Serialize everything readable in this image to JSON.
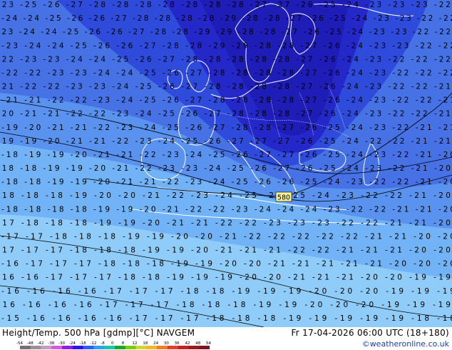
{
  "header": {
    "title": "Height/Temp. 500 hPa [gdmp][°C] NAVGEM",
    "datetime": "Fr 17-04-2026 06:00 UTC (18+180)",
    "credit": "©weatheronline.co.uk"
  },
  "contour_label": "580",
  "colorbar": {
    "ticks": [
      "-54",
      "-48",
      "-42",
      "-38",
      "-30",
      "-24",
      "-18",
      "-12",
      "-8",
      "0",
      "8",
      "12",
      "18",
      "24",
      "30",
      "36",
      "42",
      "48",
      "54"
    ],
    "colors": [
      "#7d6d77",
      "#9d8f98",
      "#c59cc6",
      "#d45bd9",
      "#8e1fdc",
      "#2b14e7",
      "#2f5ff2",
      "#2fa2ec",
      "#16c7a9",
      "#16a82b",
      "#7dcb0f",
      "#d0d72e",
      "#f2b524",
      "#ee7f25",
      "#e2402a",
      "#c61f25",
      "#9e1820",
      "#7a1420"
    ]
  },
  "temperature_rows": [
    "-23 -25 -26 -27 -28 -28 -28 -28 -28 -28 -28 -27 -27 -26 -25 -24 -23 -23 -23 -22",
    "-24 -24 -25 -26 -26 -27 -28 -28 -28 -28 -29 -28 -28 -27 -26 -25 -24 -23 -23 -22 -22",
    "-23 -24 -24 -25 -26 -26 -27 -28 -28 -29 -29 -28 -28 -27 -26 -25 -24 -23 -23 -22 -22",
    "-23 -24 -24 -25 -26 -26 -27 -28 -28 -29 -29 -28 -28 -27 -26 -24 -23 -23 -22 -22",
    "-22 -23 -23 -24 -24 -25 -26 -27 -28 -28 -28 -28 -28 -27 -26 -24 -23 -22 -22 -22",
    "-22 -22 -23 -23 -24 -24 -25 -26 -27 -28 -28 -28 -28 -27 -26 -24 -23 -22 -22 -22",
    "-21 -22 -22 -23 -23 -24 -25 -26 -27 -28 -28 -28 -28 -27 -26 -24 -23 -22 -22 -21",
    "-21 -21 -22 -22 -23 -24 -25 -26 -27 -28 -28 -28 -28 -27 -26 -24 -23 -22 -22 -21",
    "-20 -21 -21 -22 -22 -23 -24 -25 -26 -27 -28 -28 -28 -27 -26 -24 -23 -22 -22 -21",
    "-19 -20 -21 -21 -22 -23 -24 -25 -26 -27 -28 -28 -27 -26 -25 -24 -23 -22 -21 -21",
    "-19 -19 -20 -21 -21 -22 -23 -24 -25 -26 -27 -27 -27 -26 -25 -24 -22 -22 -21 -21",
    "-18 -19 -19 -20 -21 -21 -22 -23 -24 -25 -26 -27 -27 -26 -25 -24 -23 -22 -21 -20",
    "-18 -18 -19 -19 -20 -21 -22 -23 -23 -24 -25 -26 -27 -26 -25 -24 -23 -22 -21 -20",
    "-18 -18 -19 -19 -20 -21 -21 -22 -23 -24 -25 -26 -26 -25 -24 -23 -22 -22 -21 -20",
    "-18 -18 -18 -19 -20 -20 -21 -22 -23 -24 -25 -25 -25 -24 -23 -22 -22 -21 -20",
    "-18 -18 -18 -18 -19 -19 -20 -21 -22 -22 -23 -24 -24 -24 -23 -22 -22 -21 -21 -20",
    "-17 -18 -18 -18 -19 -19 -20 -21 -21 -22 -22 -23 -23 -23 -22 -22 -21 -21 -20",
    "-17 -17 -18 -18 -18 -19 -19 -20 -20 -21 -22 -22 -22 -22 -22 -21 -21 -20 -20",
    "-17 -17 -17 -18 -18 -18 -19 -19 -20 -21 -21 -21 -22 -22 -21 -21 -21 -20 -20",
    "-16 -17 -17 -17 -18 -18 -18 -19 -19 -20 -20 -21 -21 -21 -21 -21 -20 -20 -20",
    "-16 -16 -17 -17 -17 -18 -18 -19 -19 -19 -20 -20 -21 -21 -21 -20 -20 -19 -19",
    "-16 -16 -16 -16 -17 -17 -17 -18 -18 -19 -19 -19 -20 -20 -20 -19 -19 -19",
    "-16 -16 -16 -16 -17 -17 -17 -18 -18 -18 -19 -19 -20 -20 -20 -19 -19 -19",
    "-15 -16 -16 -16 -16 -17 -17 -17 -18 -18 -18 -19 -19 -19 -19 -19 -18 -18"
  ]
}
